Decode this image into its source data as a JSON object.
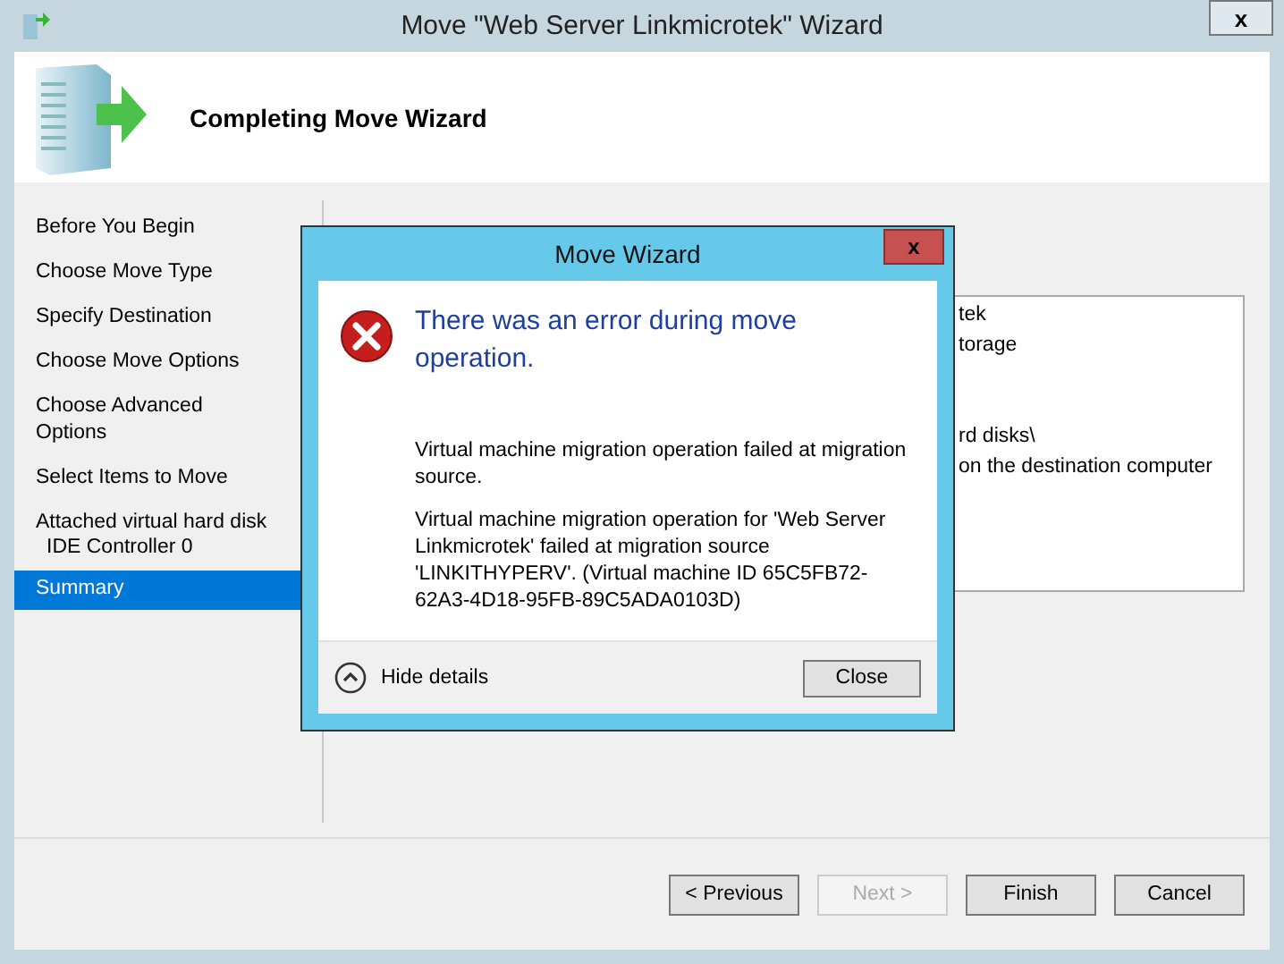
{
  "window": {
    "title": "Move \"Web Server Linkmicrotek\" Wizard",
    "close": "x"
  },
  "header": {
    "title": "Completing Move Wizard"
  },
  "steps": [
    {
      "label": "Before You Begin",
      "selected": false
    },
    {
      "label": "Choose Move Type",
      "selected": false
    },
    {
      "label": "Specify Destination",
      "selected": false
    },
    {
      "label": "Choose Move Options",
      "selected": false
    },
    {
      "label": "Choose Advanced Options",
      "selected": false
    },
    {
      "label": "Select Items to Move",
      "selected": false
    },
    {
      "label": "Attached virtual hard disk",
      "sublabel": "IDE Controller 0",
      "selected": false
    },
    {
      "label": "Summary",
      "selected": true
    }
  ],
  "summary_lines": [
    {
      "kind": "text",
      "text": "tek"
    },
    {
      "kind": "text",
      "text": "torage"
    },
    {
      "kind": "blank"
    },
    {
      "kind": "blank"
    },
    {
      "kind": "text",
      "text": "rd disks\\"
    },
    {
      "kind": "text",
      "text": "on the destination computer"
    }
  ],
  "buttons": [
    {
      "label": "< Previous",
      "disabled": false
    },
    {
      "label": "Next >",
      "disabled": true
    },
    {
      "label": "Finish",
      "disabled": false
    },
    {
      "label": "Cancel",
      "disabled": false
    }
  ],
  "dialog": {
    "title": "Move Wizard",
    "close": "x",
    "heading": "There was an error during move operation.",
    "messages": [
      "Virtual machine migration operation failed at migration source.",
      "Virtual machine migration operation for 'Web Server Linkmicrotek' failed at migration source 'LINKITHYPERV'. (Virtual machine ID 65C5FB72-62A3-4D18-95FB-89C5ADA0103D)"
    ],
    "details_toggle": "Hide details",
    "button": "Close"
  }
}
